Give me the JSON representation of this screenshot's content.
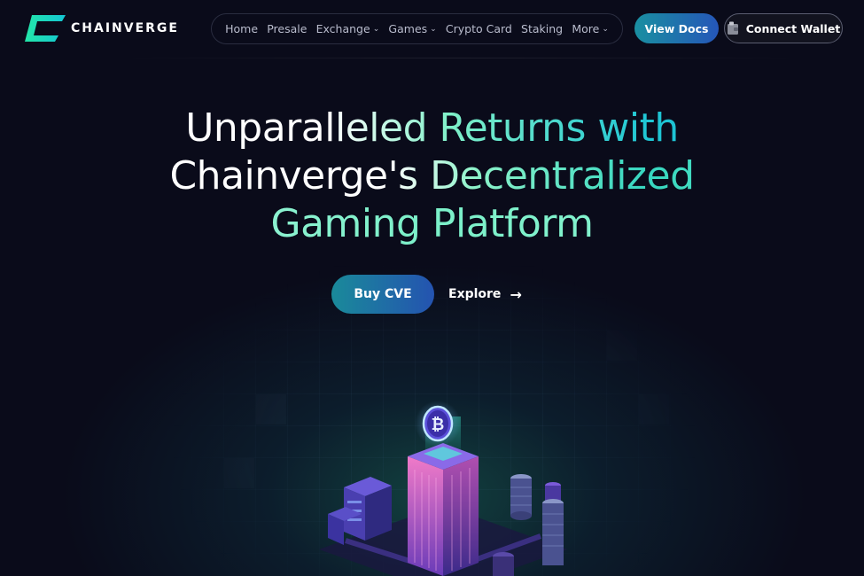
{
  "brand": {
    "name": "CHAINVERGE",
    "logo_icon": "chainverge-logo-icon",
    "accent_color": "#1de6c0"
  },
  "nav": {
    "items": [
      {
        "label": "Home",
        "has_dropdown": false
      },
      {
        "label": "Presale",
        "has_dropdown": false
      },
      {
        "label": "Exchange",
        "has_dropdown": true
      },
      {
        "label": "Games",
        "has_dropdown": true
      },
      {
        "label": "Crypto Card",
        "has_dropdown": false
      },
      {
        "label": "Staking",
        "has_dropdown": false
      },
      {
        "label": "More",
        "has_dropdown": true
      }
    ]
  },
  "header": {
    "docs_label": "View Docs",
    "wallet_label": "Connect Wallet",
    "wallet_icon": "wallet-icon"
  },
  "hero": {
    "title_line1": "Unparalleled Returns with",
    "title_line2": "Chainverge's Decentralized",
    "title_line3": "Gaming Platform",
    "buy_label": "Buy CVE",
    "explore_label": "Explore",
    "explore_icon": "arrow-right-icon"
  },
  "illustration": {
    "icon": "bitcoin-icon",
    "glyph": "₿"
  },
  "colors": {
    "background": "#0a0b1a",
    "button_gradient_start": "#1a8fa1",
    "button_gradient_end": "#2556b8",
    "title_teal": "#7ff0c8"
  }
}
